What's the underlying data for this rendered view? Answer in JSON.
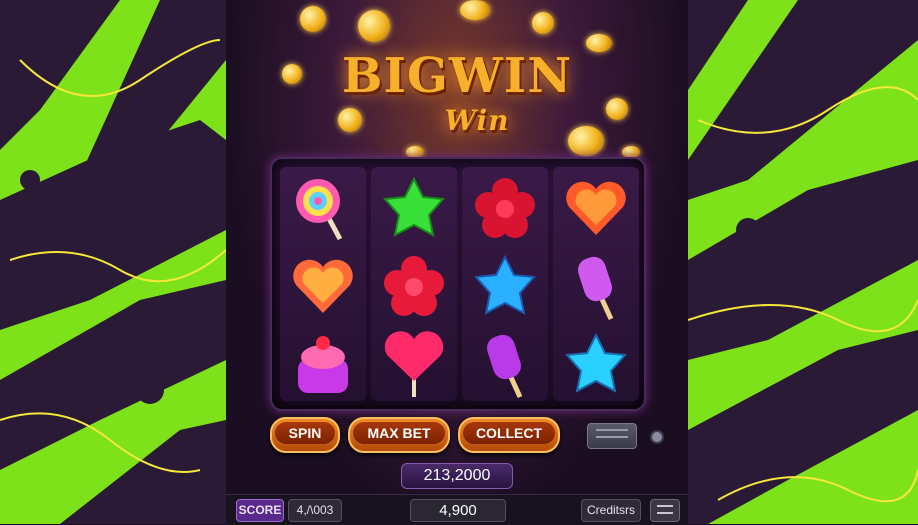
{
  "title": {
    "line1": "BIGWIN",
    "line2": "Win"
  },
  "controls": {
    "spin": "SPIN",
    "max_bet": "MAX BET",
    "collect": "COLLECT"
  },
  "total_display": "213,2000",
  "bottom_bar": {
    "score_label": "SCORE",
    "score_value": "4,/\\003",
    "center_value": "4,900",
    "credits_label": "Creditsrs"
  },
  "reels": [
    [
      "lollipop",
      "heart-candy",
      "cupcake-candy"
    ],
    [
      "green-star-candy",
      "red-gummy-flower",
      "heart-lollipop"
    ],
    [
      "red-gummy-flower",
      "blue-star-candy",
      "popsicle"
    ],
    [
      "heart-candy",
      "popsicle",
      "blue-star-candy"
    ]
  ],
  "colors": {
    "accent_orange": "#f08a28",
    "gold": "#f7b02a",
    "slime_green": "#7ee21a",
    "purple_dark": "#2a1236"
  }
}
